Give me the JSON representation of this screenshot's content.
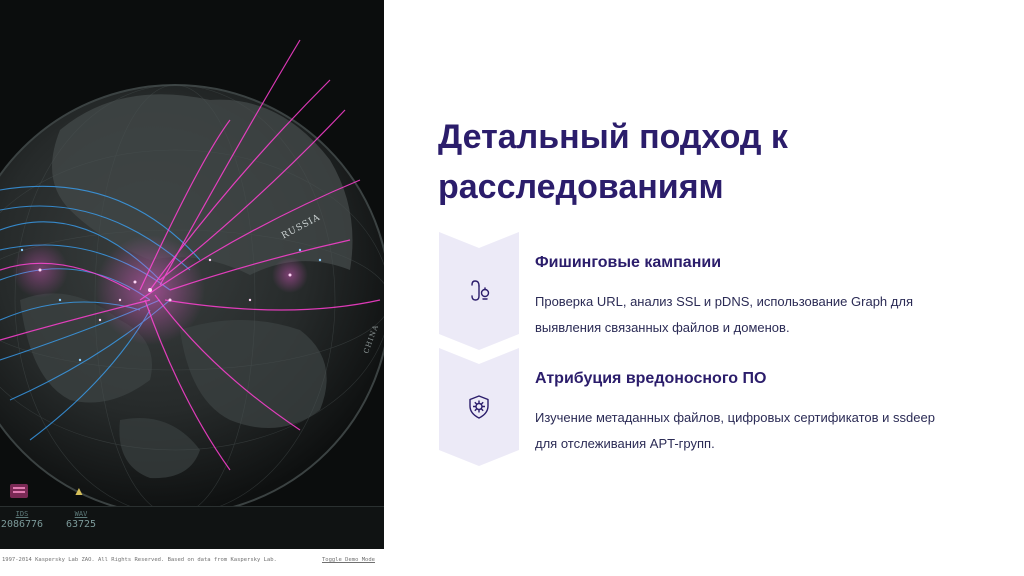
{
  "map": {
    "countries": {
      "russia": "RUSSIA",
      "china": "CHINA"
    },
    "stats": [
      {
        "label": "IDS",
        "value": "2086776"
      },
      {
        "label": "WAV",
        "value": "63725"
      }
    ],
    "footer": {
      "copyright": "1997-2014 Kaspersky Lab ZAO. All Rights Reserved. Based on data from Kaspersky Lab.",
      "toggle": "Toggle Demo Mode"
    }
  },
  "slide": {
    "title_line1": "Детальный подход к",
    "title_line2": "расследованиям",
    "items": [
      {
        "icon": "phishing-hook-icon",
        "title": "Фишинговые кампании",
        "desc_line1": "Проверка URL, анализ SSL и pDNS, использование Graph для",
        "desc_line2": "выявления связанных файлов и доменов."
      },
      {
        "icon": "shield-virus-icon",
        "title": "Атрибуция вредоносного ПО",
        "desc_line1": "Изучение метаданных файлов, цифровых сертификатов и ssdeep",
        "desc_line2": "для отслеживания APT-групп."
      }
    ]
  },
  "colors": {
    "accent": "#2b1d6b",
    "chevron": "#eceaf7",
    "arc_pink": "#ff3fd2",
    "arc_blue": "#3aa7ff"
  }
}
